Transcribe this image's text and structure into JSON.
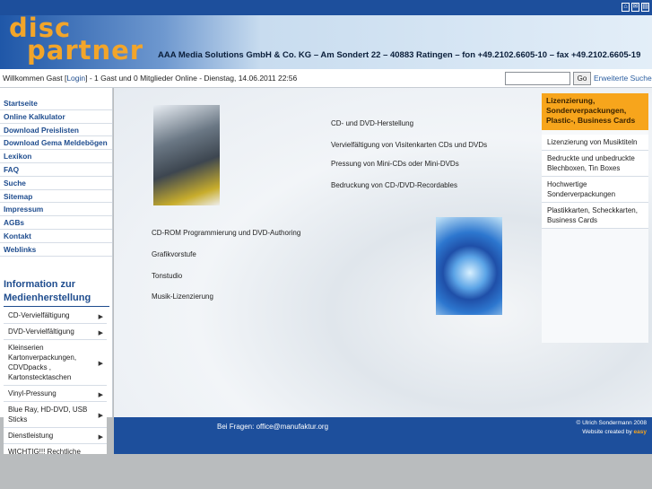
{
  "header": {
    "logo_line1": "disc",
    "logo_line2": "partner",
    "company": "AAA Media Solutions GmbH & Co. KG  –  Am Sondert 22  –  40883 Ratingen  –  fon +49.2102.6605-10  –  fax +49.2102.6605-19"
  },
  "userbar": {
    "welcome_prefix": "Willkommen Gast [",
    "login": "Login",
    "welcome_suffix": "] - 1 Gast und 0 Mitglieder Online - Dienstag, 14.06.2011 22:56",
    "search_value": "",
    "go_label": "Go",
    "advanced_search": "Erweiterte Suche"
  },
  "menu": [
    "Startseite",
    "Online Kalkulator",
    "Download Preislisten",
    "Download Gema Meldebögen",
    "Lexikon",
    "FAQ",
    "Suche",
    "Sitemap",
    "Impressum",
    "AGBs",
    "Kontakt",
    "Weblinks"
  ],
  "info": {
    "title_line1": "Information zur",
    "title_line2": "Medienherstellung",
    "items": [
      "CD-Vervielfältigung",
      "DVD-Vervielfältigung",
      "Kleinserien Kartonverpackungen, CDVDpacks , Kartonstecktaschen",
      "Vinyl-Pressung",
      "Blue Ray, HD-DVD, USB Sticks",
      "Dienstleistung",
      "WICHTIG!!! Rechtliche Grundlagen für die Medienherstellung"
    ]
  },
  "main": {
    "link1": "CD- und DVD-Herstellung",
    "link2": "Vervielfältigung von Visitenkarten CDs und DVDs",
    "link3": "Pressung von Mini-CDs oder Mini-DVDs",
    "link4": "Bedruckung von CD-/DVD-Recordables",
    "link5": "CD-ROM Programmierung und DVD-Authoring",
    "link6": "Grafikvorstufe",
    "link7": "Tonstudio",
    "link8": "Musik-Lizenzierung"
  },
  "right": {
    "head": "Lizenzierung, Sonderverpackungen, Plastic-, Business Cards",
    "items": [
      "Lizenzierung von Musiktiteln",
      "Bedruckte und unbedruckte Blechboxen, Tin Boxes",
      "Hochwertige Sonderverpackungen",
      "Plastikkarten, Scheckkarten, Business Cards"
    ]
  },
  "footer": {
    "question": "Bei Fragen: office@manufaktur.org",
    "copyright": "© Ulrich Sondermann 2008",
    "created_prefix": "Website created by",
    "created_brand": "easy"
  },
  "icons": [
    "home-icon",
    "mail-icon",
    "print-icon"
  ]
}
